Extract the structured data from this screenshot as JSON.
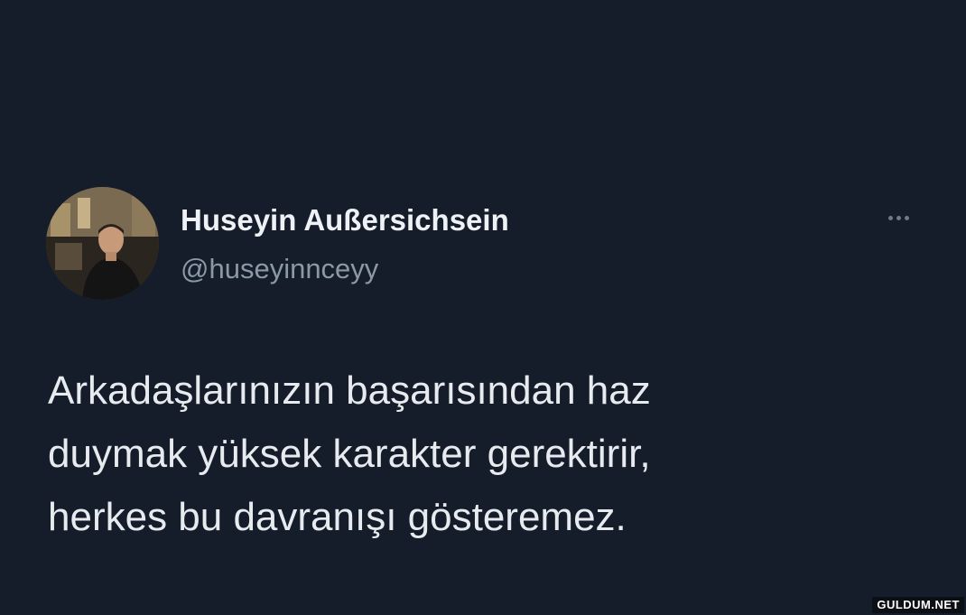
{
  "tweet": {
    "author": {
      "display_name": "Huseyin Außersichsein",
      "handle": "@huseyinnceyy"
    },
    "more_icon": "more-horizontal-icon",
    "text_lines": [
      "Arkadaşlarınızın başarısından haz",
      "duymak yüksek karakter gerektirir,",
      "herkes bu davranışı gösteremez."
    ]
  },
  "watermark": "GULDUM.NET",
  "colors": {
    "background": "#151d2a",
    "name": "#eef1f5",
    "handle": "#8b98a5",
    "text": "#e7ebef"
  }
}
